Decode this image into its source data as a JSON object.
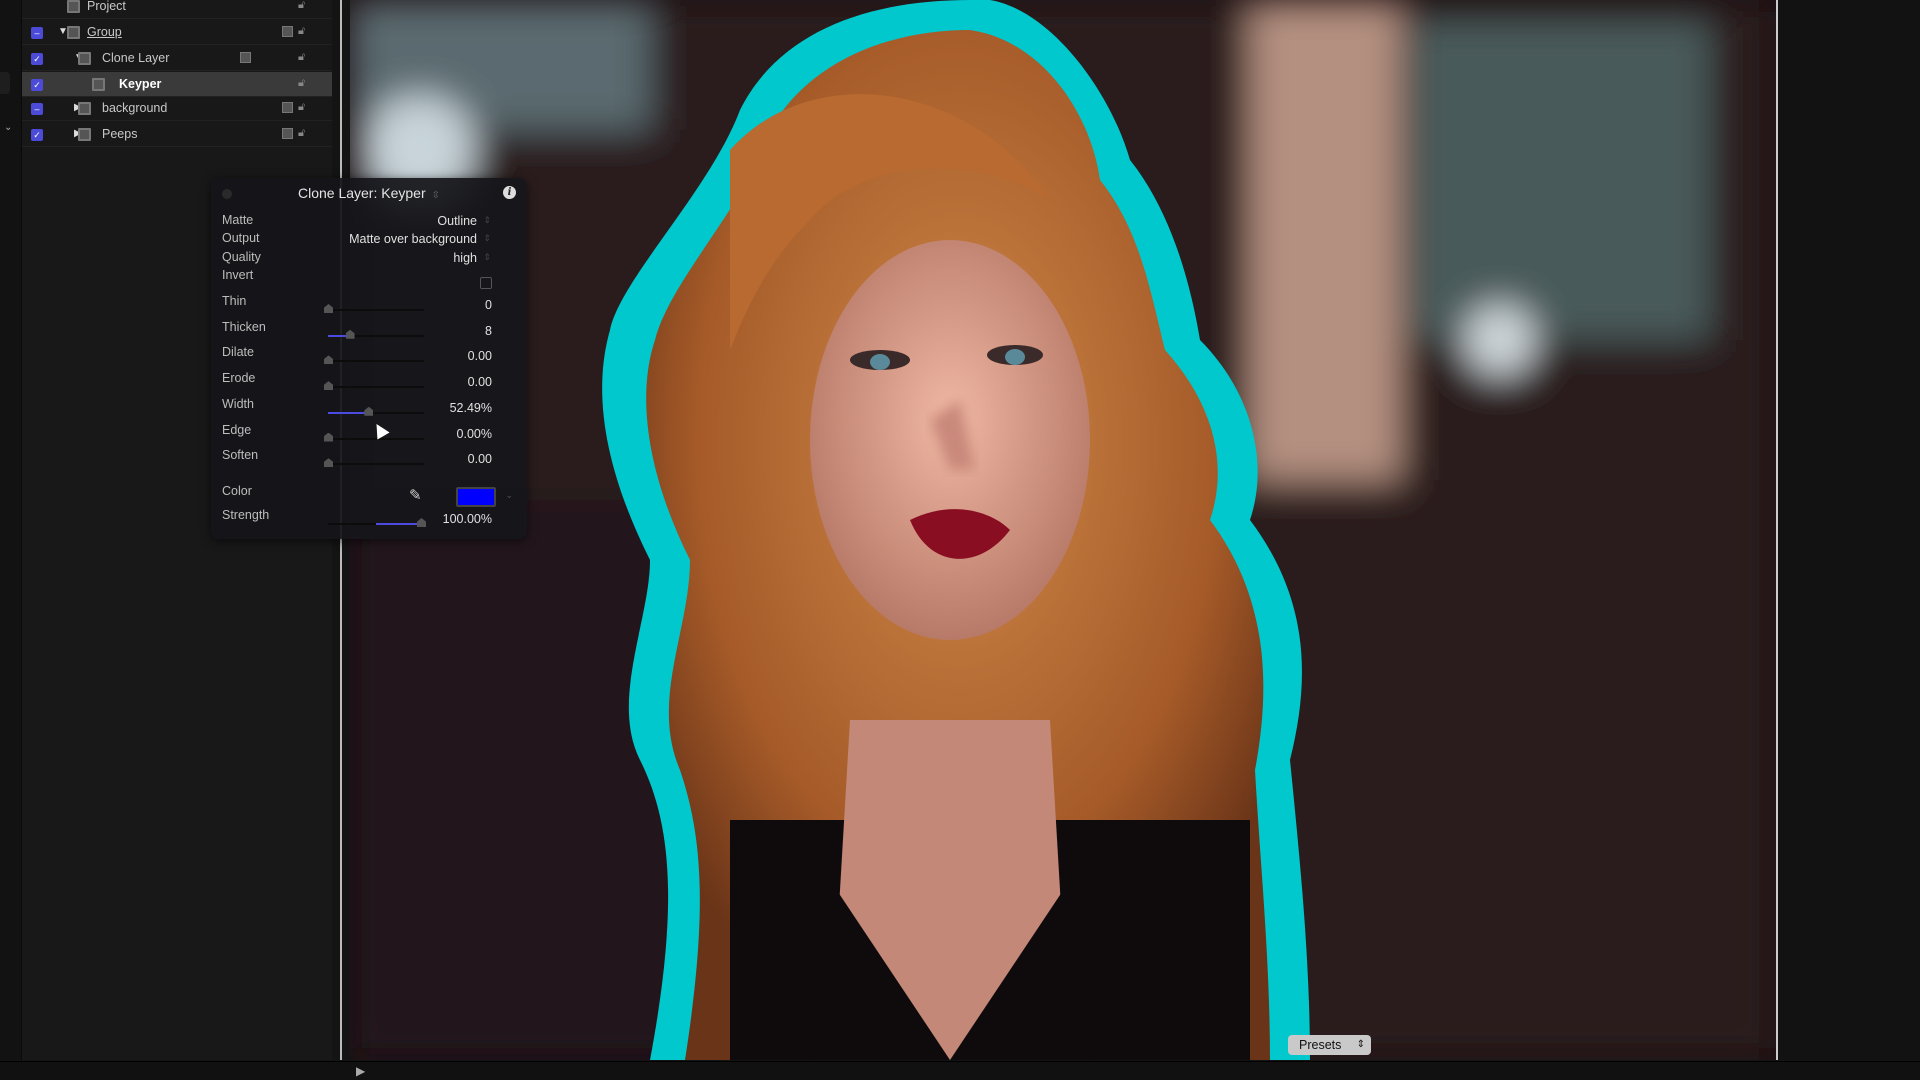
{
  "layers": [
    {
      "name": "Project",
      "checkbox": "none",
      "expand": "none",
      "icon": "project-icon"
    },
    {
      "name": "Group",
      "checkbox": "mixed",
      "expand": "expanded",
      "icon": "group-icon"
    },
    {
      "name": "Clone Layer",
      "checkbox": "checked",
      "expand": "expanded",
      "icon": "clone-layer-icon"
    },
    {
      "name": "Keyper",
      "checkbox": "checked",
      "expand": "none",
      "icon": "filter-icon",
      "selected": true
    },
    {
      "name": "background",
      "checkbox": "mixed",
      "expand": "collapsed",
      "icon": "group-icon"
    },
    {
      "name": "Peeps",
      "checkbox": "checked",
      "expand": "collapsed",
      "icon": "group-icon"
    }
  ],
  "hud": {
    "title": "Clone Layer: Keyper",
    "matte": {
      "label": "Matte",
      "value": "Outline"
    },
    "output": {
      "label": "Output",
      "value": "Matte over background"
    },
    "quality": {
      "label": "Quality",
      "value": "high"
    },
    "invert": {
      "label": "Invert",
      "checked": false
    },
    "sliders": [
      {
        "label": "Thin",
        "value": "0",
        "level": 0
      },
      {
        "label": "Thicken",
        "value": "8",
        "level": 0.28
      },
      {
        "label": "Dilate",
        "value": "0.00",
        "level": 0
      },
      {
        "label": "Erode",
        "value": "0.00",
        "level": 0
      },
      {
        "label": "Width",
        "value": "52.49%",
        "level": 0.5249
      },
      {
        "label": "Edge",
        "value": "0.00%",
        "level": 0
      },
      {
        "label": "Soften",
        "value": "0.00",
        "level": 0
      }
    ],
    "color": {
      "label": "Color",
      "value": "#0000ff"
    },
    "strength": {
      "label": "Strength",
      "value": "100.00%",
      "level": 1
    }
  },
  "presets_label": "Presets",
  "colors": {
    "accent": "#4b4bd8",
    "outline": "#00c8cc"
  }
}
